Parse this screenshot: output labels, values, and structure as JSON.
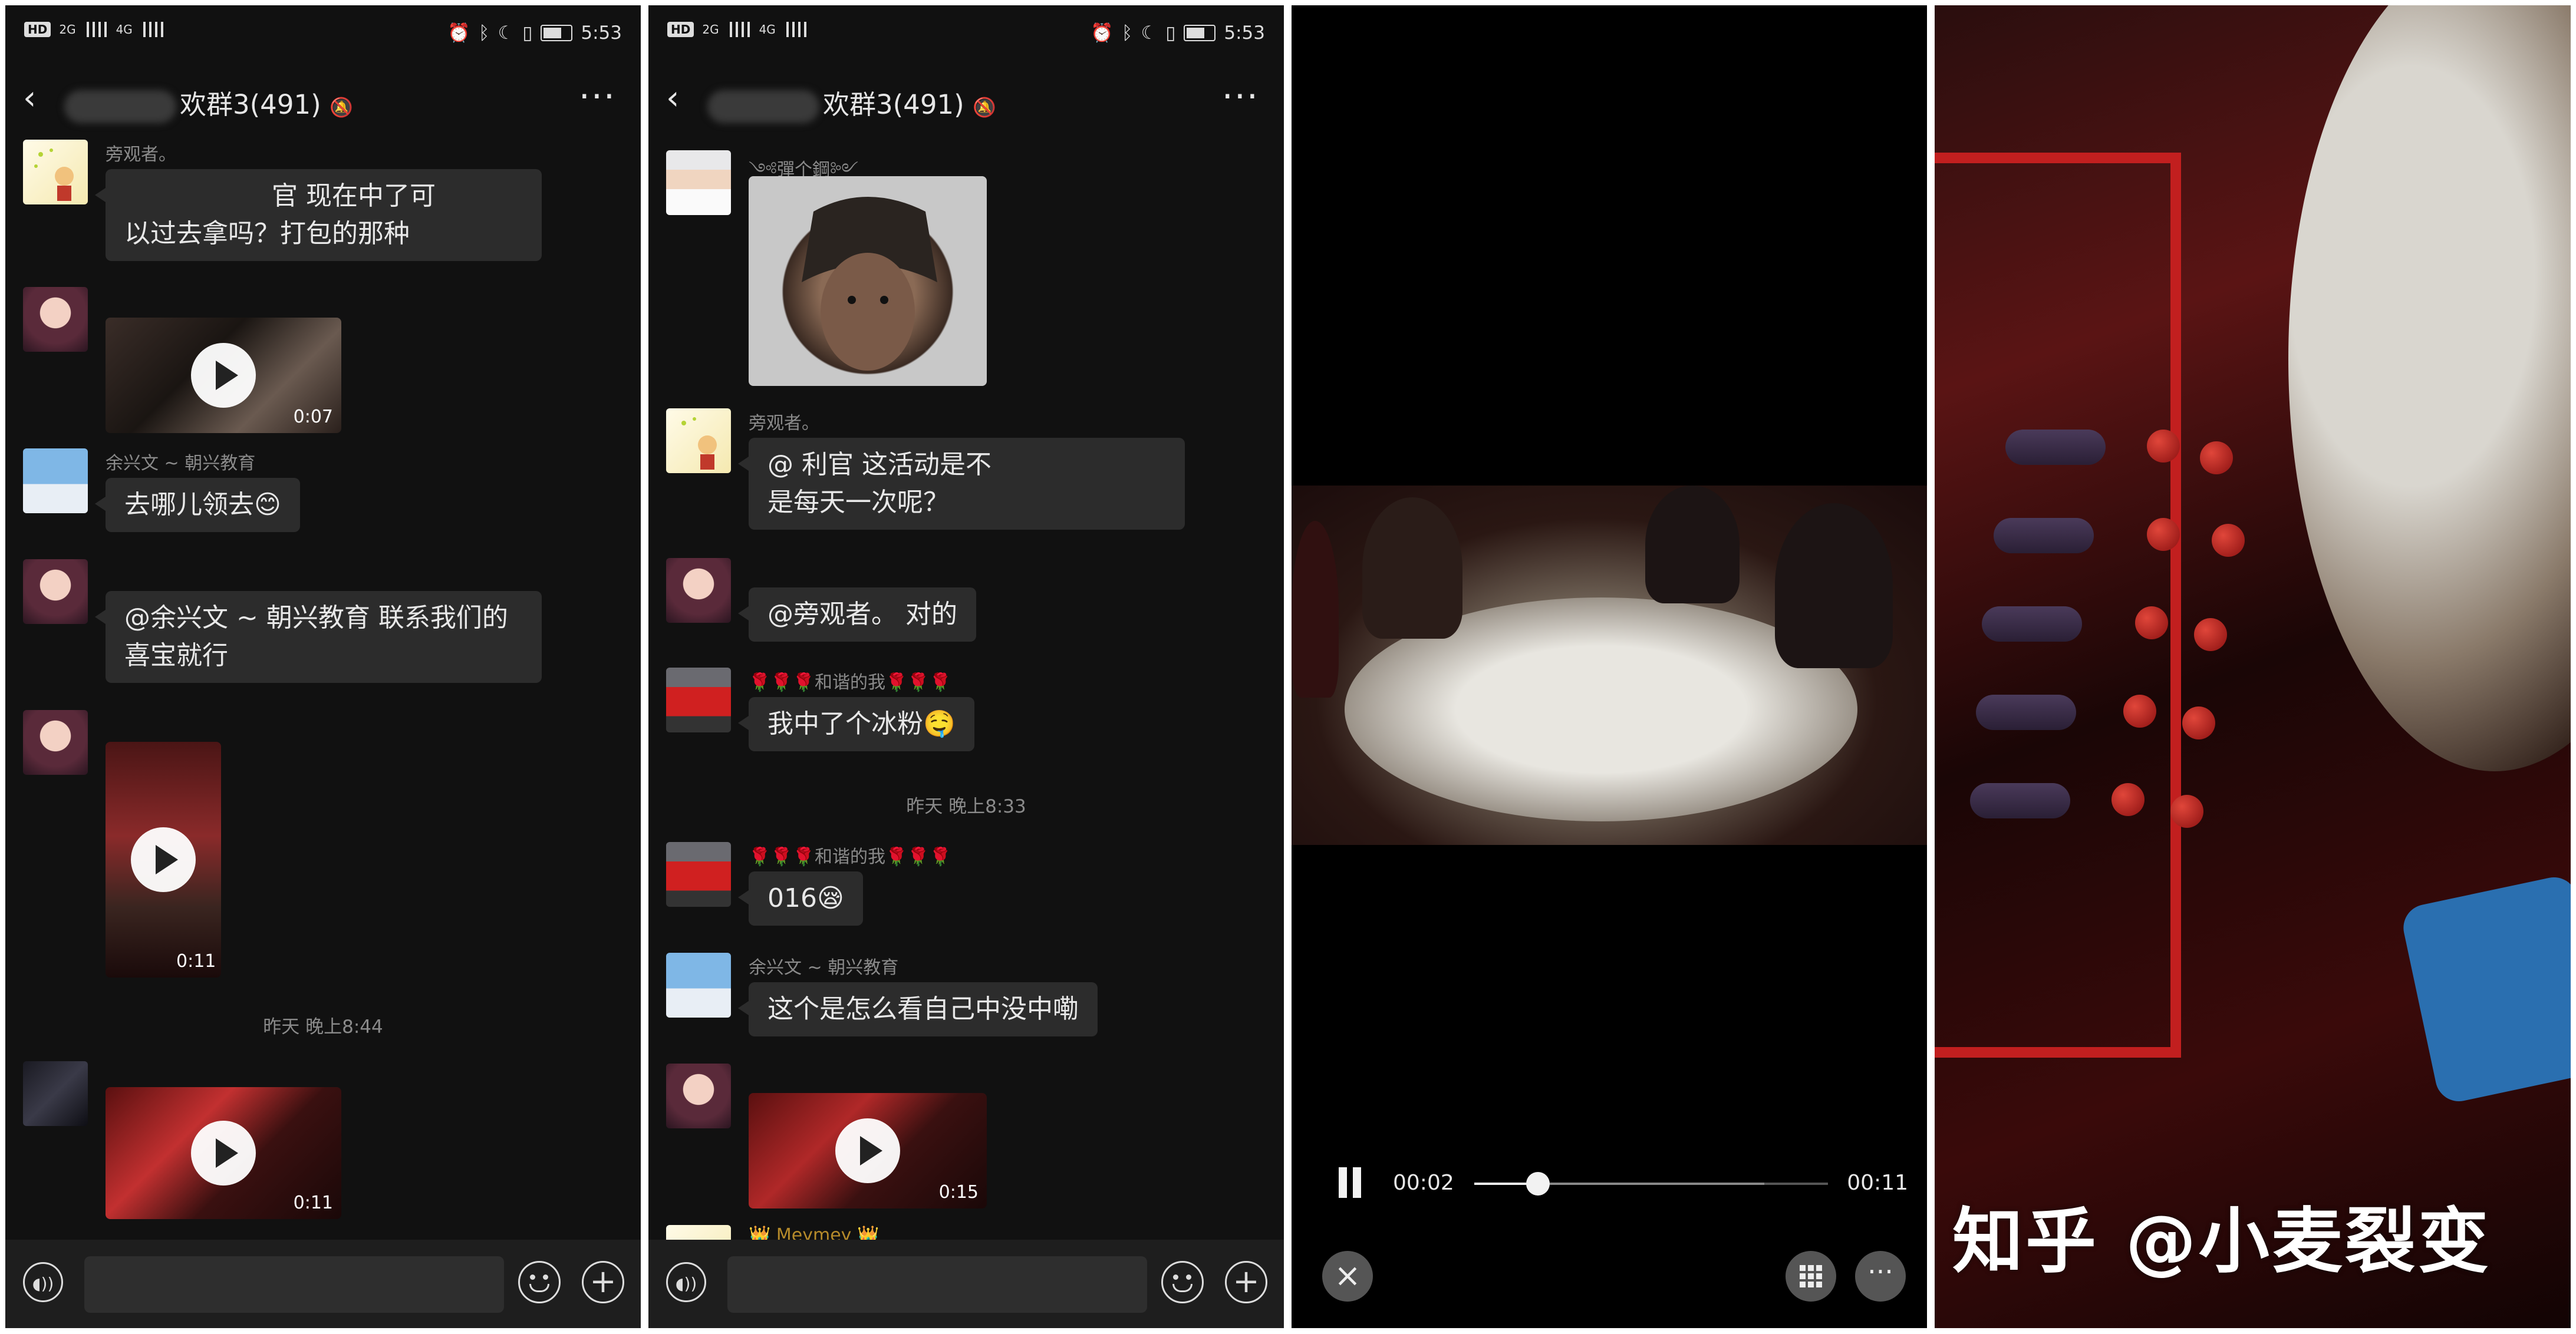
{
  "status_bar": {
    "hd": "HD",
    "sig1": "2G",
    "sig2": "4G",
    "time": "5:53"
  },
  "left_chat": {
    "title": "欢群3(491)",
    "messages": [
      {
        "nick": "旁观者。",
        "text1": "官  现在中了可",
        "text2": "以过去拿吗？打包的那种"
      },
      {
        "nick": "",
        "duration": "0:07"
      },
      {
        "nick": "余兴文 ~ 朝兴教育",
        "text": "去哪儿领去😊"
      },
      {
        "nick": "",
        "text1": "@余兴文 ~ 朝兴教育  联系我们的",
        "text2": "喜宝就行"
      },
      {
        "nick": "",
        "duration": "0:11"
      },
      {
        "timestamp": "昨天 晚上8:44"
      },
      {
        "nick": "",
        "duration": "0:11"
      }
    ]
  },
  "right_chat": {
    "title": "欢群3(491)",
    "messages": [
      {
        "nick": "༺彈个鋼༻"
      },
      {
        "nick": "旁观者。",
        "text1": "@                利官  这活动是不",
        "text2": "是每天一次呢？"
      },
      {
        "nick": "",
        "text": "@旁观者。 对的"
      },
      {
        "nick": "🌹🌹🌹和谐的我🌹🌹🌹",
        "text": "我中了个冰粉🤤"
      },
      {
        "timestamp": "昨天 晚上8:33"
      },
      {
        "nick": "🌹🌹🌹和谐的我🌹🌹🌹",
        "text": "016😪"
      },
      {
        "nick": "余兴文 ~ 朝兴教育",
        "text": "这个是怎么看自己中没中嘞"
      },
      {
        "nick": "",
        "duration": "0:15"
      },
      {
        "nick": "👑 Meymey 👑"
      }
    ]
  },
  "player": {
    "current": "00:02",
    "total": "00:11",
    "progress": 0.18,
    "buffered": 0.82
  },
  "watermark": "知乎 @小麦裂变"
}
